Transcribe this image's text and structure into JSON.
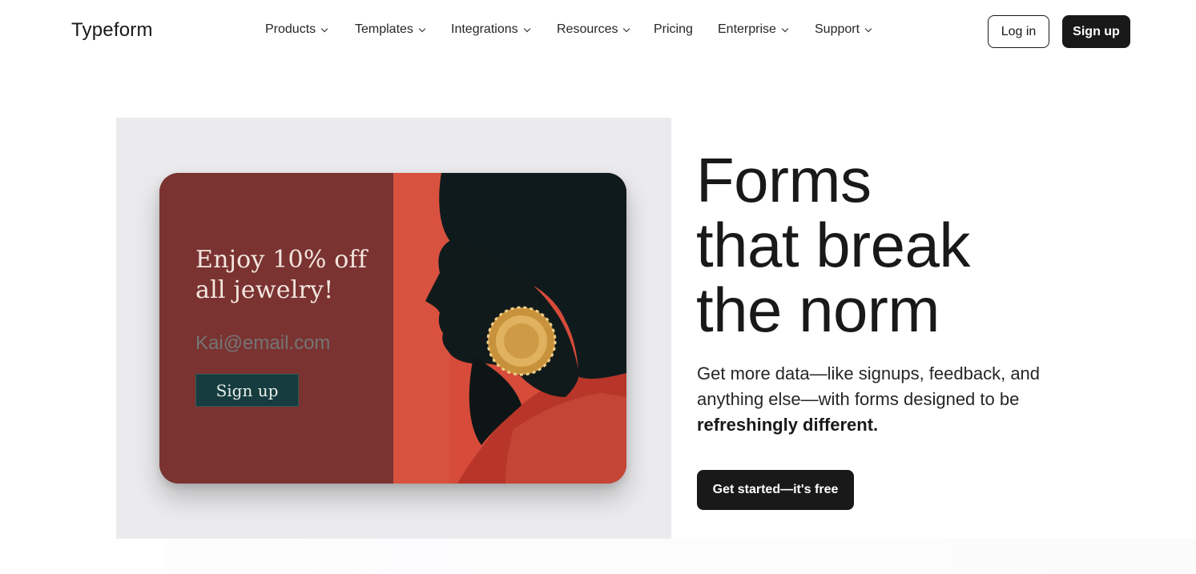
{
  "header": {
    "logo": "Typeform",
    "nav": [
      {
        "label": "Products",
        "dropdown": true
      },
      {
        "label": "Templates",
        "dropdown": true
      },
      {
        "label": "Integrations",
        "dropdown": true
      },
      {
        "label": "Resources",
        "dropdown": true
      },
      {
        "label": "Pricing",
        "dropdown": false
      },
      {
        "label": "Enterprise",
        "dropdown": true
      },
      {
        "label": "Support",
        "dropdown": true
      }
    ],
    "login_label": "Log in",
    "signup_label": "Sign up"
  },
  "media_card": {
    "headline_line1": "Enjoy 10% off",
    "headline_line2": "all jewelry!",
    "email_placeholder": "Kai@email.com",
    "button_label": "Sign up",
    "colors": {
      "panel": "#7a3331",
      "photo_bg": "#d64b3a",
      "button": "#163c3f"
    }
  },
  "hero": {
    "title_line1": "Forms",
    "title_line2": "that break",
    "title_line3": "the norm",
    "subtitle_text": "Get more data—like signups, feedback, and anything else—with forms designed to be",
    "subtitle_emphasis": "refreshingly different.",
    "cta_label": "Get started—it's free"
  },
  "colors": {
    "primary": "#191919",
    "background": "#ffffff",
    "media_bg": "#ebebed"
  }
}
